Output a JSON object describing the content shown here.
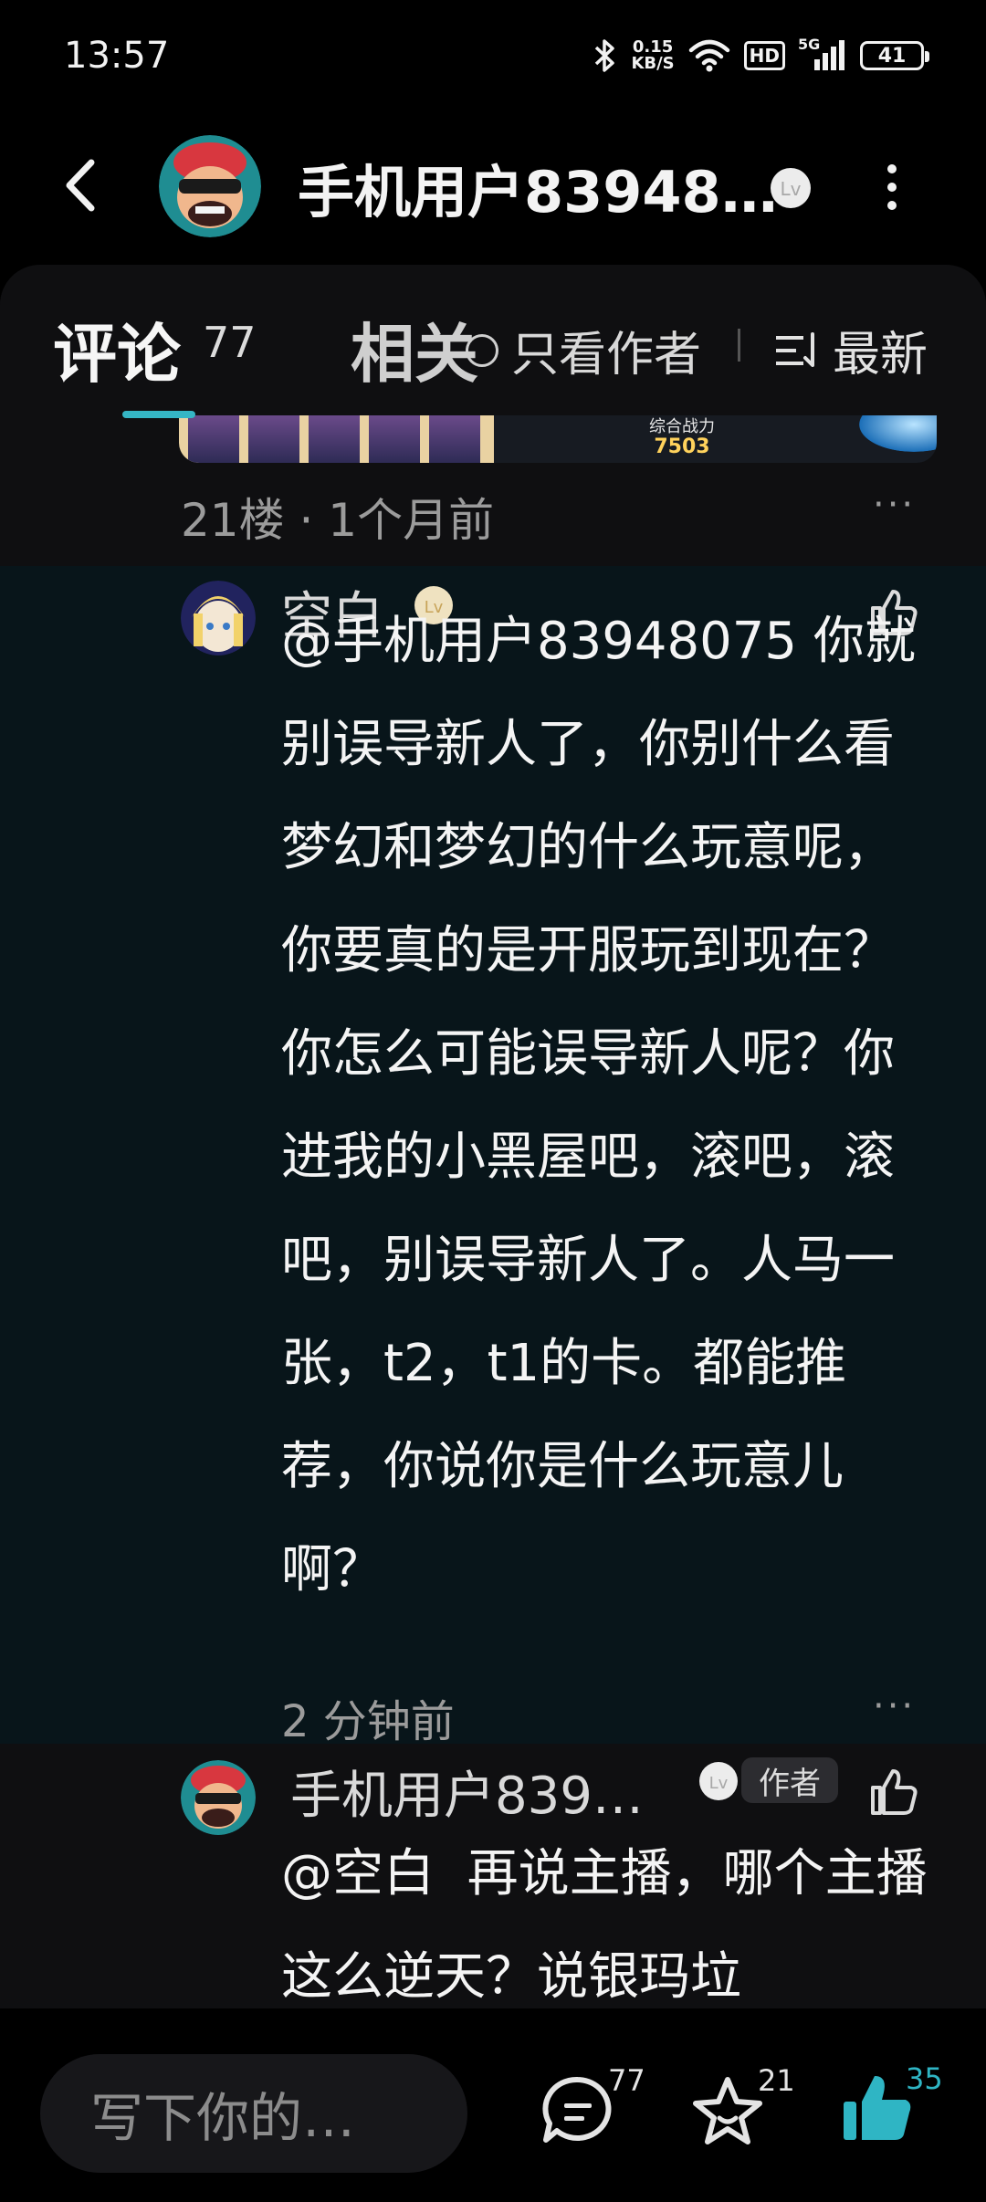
{
  "status_bar": {
    "time": "13:57",
    "net_speed_value": "0.15",
    "net_speed_unit": "KB/S",
    "hd": "HD",
    "signal": "5G",
    "battery": "41"
  },
  "header": {
    "title": "手机用户83948…"
  },
  "tabs": {
    "comments_label": "评论",
    "comments_count": "77",
    "related_label": "相关",
    "author_only_label": "只看作者",
    "sort_label": "最新"
  },
  "image_strip": {
    "power_label": "综合战力",
    "power_value": "7503"
  },
  "floor": {
    "label": "21楼 · 1个月前"
  },
  "reply_1": {
    "username": "空白",
    "mention": "@手机用户83948075",
    "text": "你就别误导新人了，你别什么看梦幻和梦幻的什么玩意呢，你要真的是开服玩到现在？你怎么可能误导新人呢？你进我的小黑屋吧，滚吧，滚吧，别误导新人了。人马一张，t2，t1的卡。都能推荐，你说你是什么玩意儿啊？",
    "time": "2 分钟前"
  },
  "reply_2": {
    "username": "手机用户839…",
    "author_tag": "作者",
    "mention": "@空白",
    "text": "再说主播，哪个主播这么逆天？说银玛垃"
  },
  "bottom_bar": {
    "input_placeholder": "写下你的…",
    "comment_count": "77",
    "favorite_count": "21",
    "like_count": "35"
  },
  "colors": {
    "accent": "#35b6c5",
    "like_active": "#2fb5c4",
    "highlight_bg": "#08151a"
  }
}
